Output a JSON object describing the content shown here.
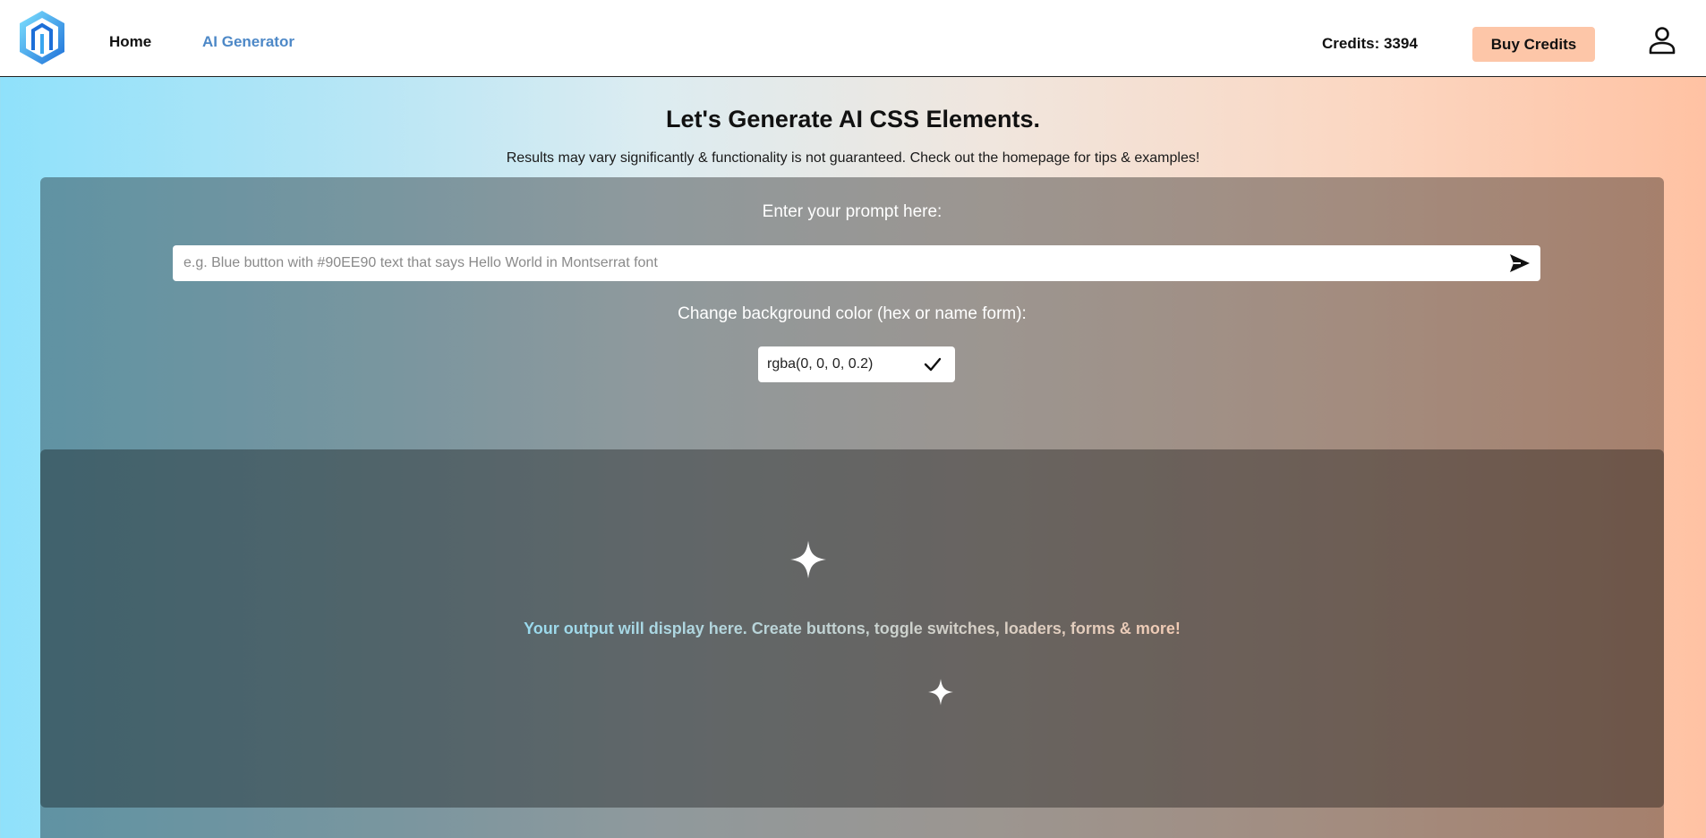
{
  "nav": {
    "home": "Home",
    "ai_generator": "AI Generator",
    "credits": "Credits: 3394",
    "buy_credits": "Buy Credits",
    "logo_icon": "logo-icon",
    "user_icon": "user-icon"
  },
  "header": {
    "title": "Let's Generate AI CSS Elements.",
    "subtitle": "Results may vary significantly & functionality is not guaranteed. Check out the homepage for tips & examples!"
  },
  "prompt": {
    "label": "Enter your prompt here:",
    "placeholder": "e.g. Blue button with #90EE90 text that says Hello World in Montserrat font",
    "value": ""
  },
  "background": {
    "label": "Change background color (hex or name form):",
    "value": "rgba(0, 0, 0, 0.2)"
  },
  "output": {
    "message": "Your output will display here. Create buttons, toggle switches, loaders, forms & more!"
  },
  "colors": {
    "accent_blue": "#4d88c7",
    "buy_button": "#fdc6a8",
    "gradient_left": "#8fe1fb",
    "gradient_right": "#ffc2a3"
  }
}
